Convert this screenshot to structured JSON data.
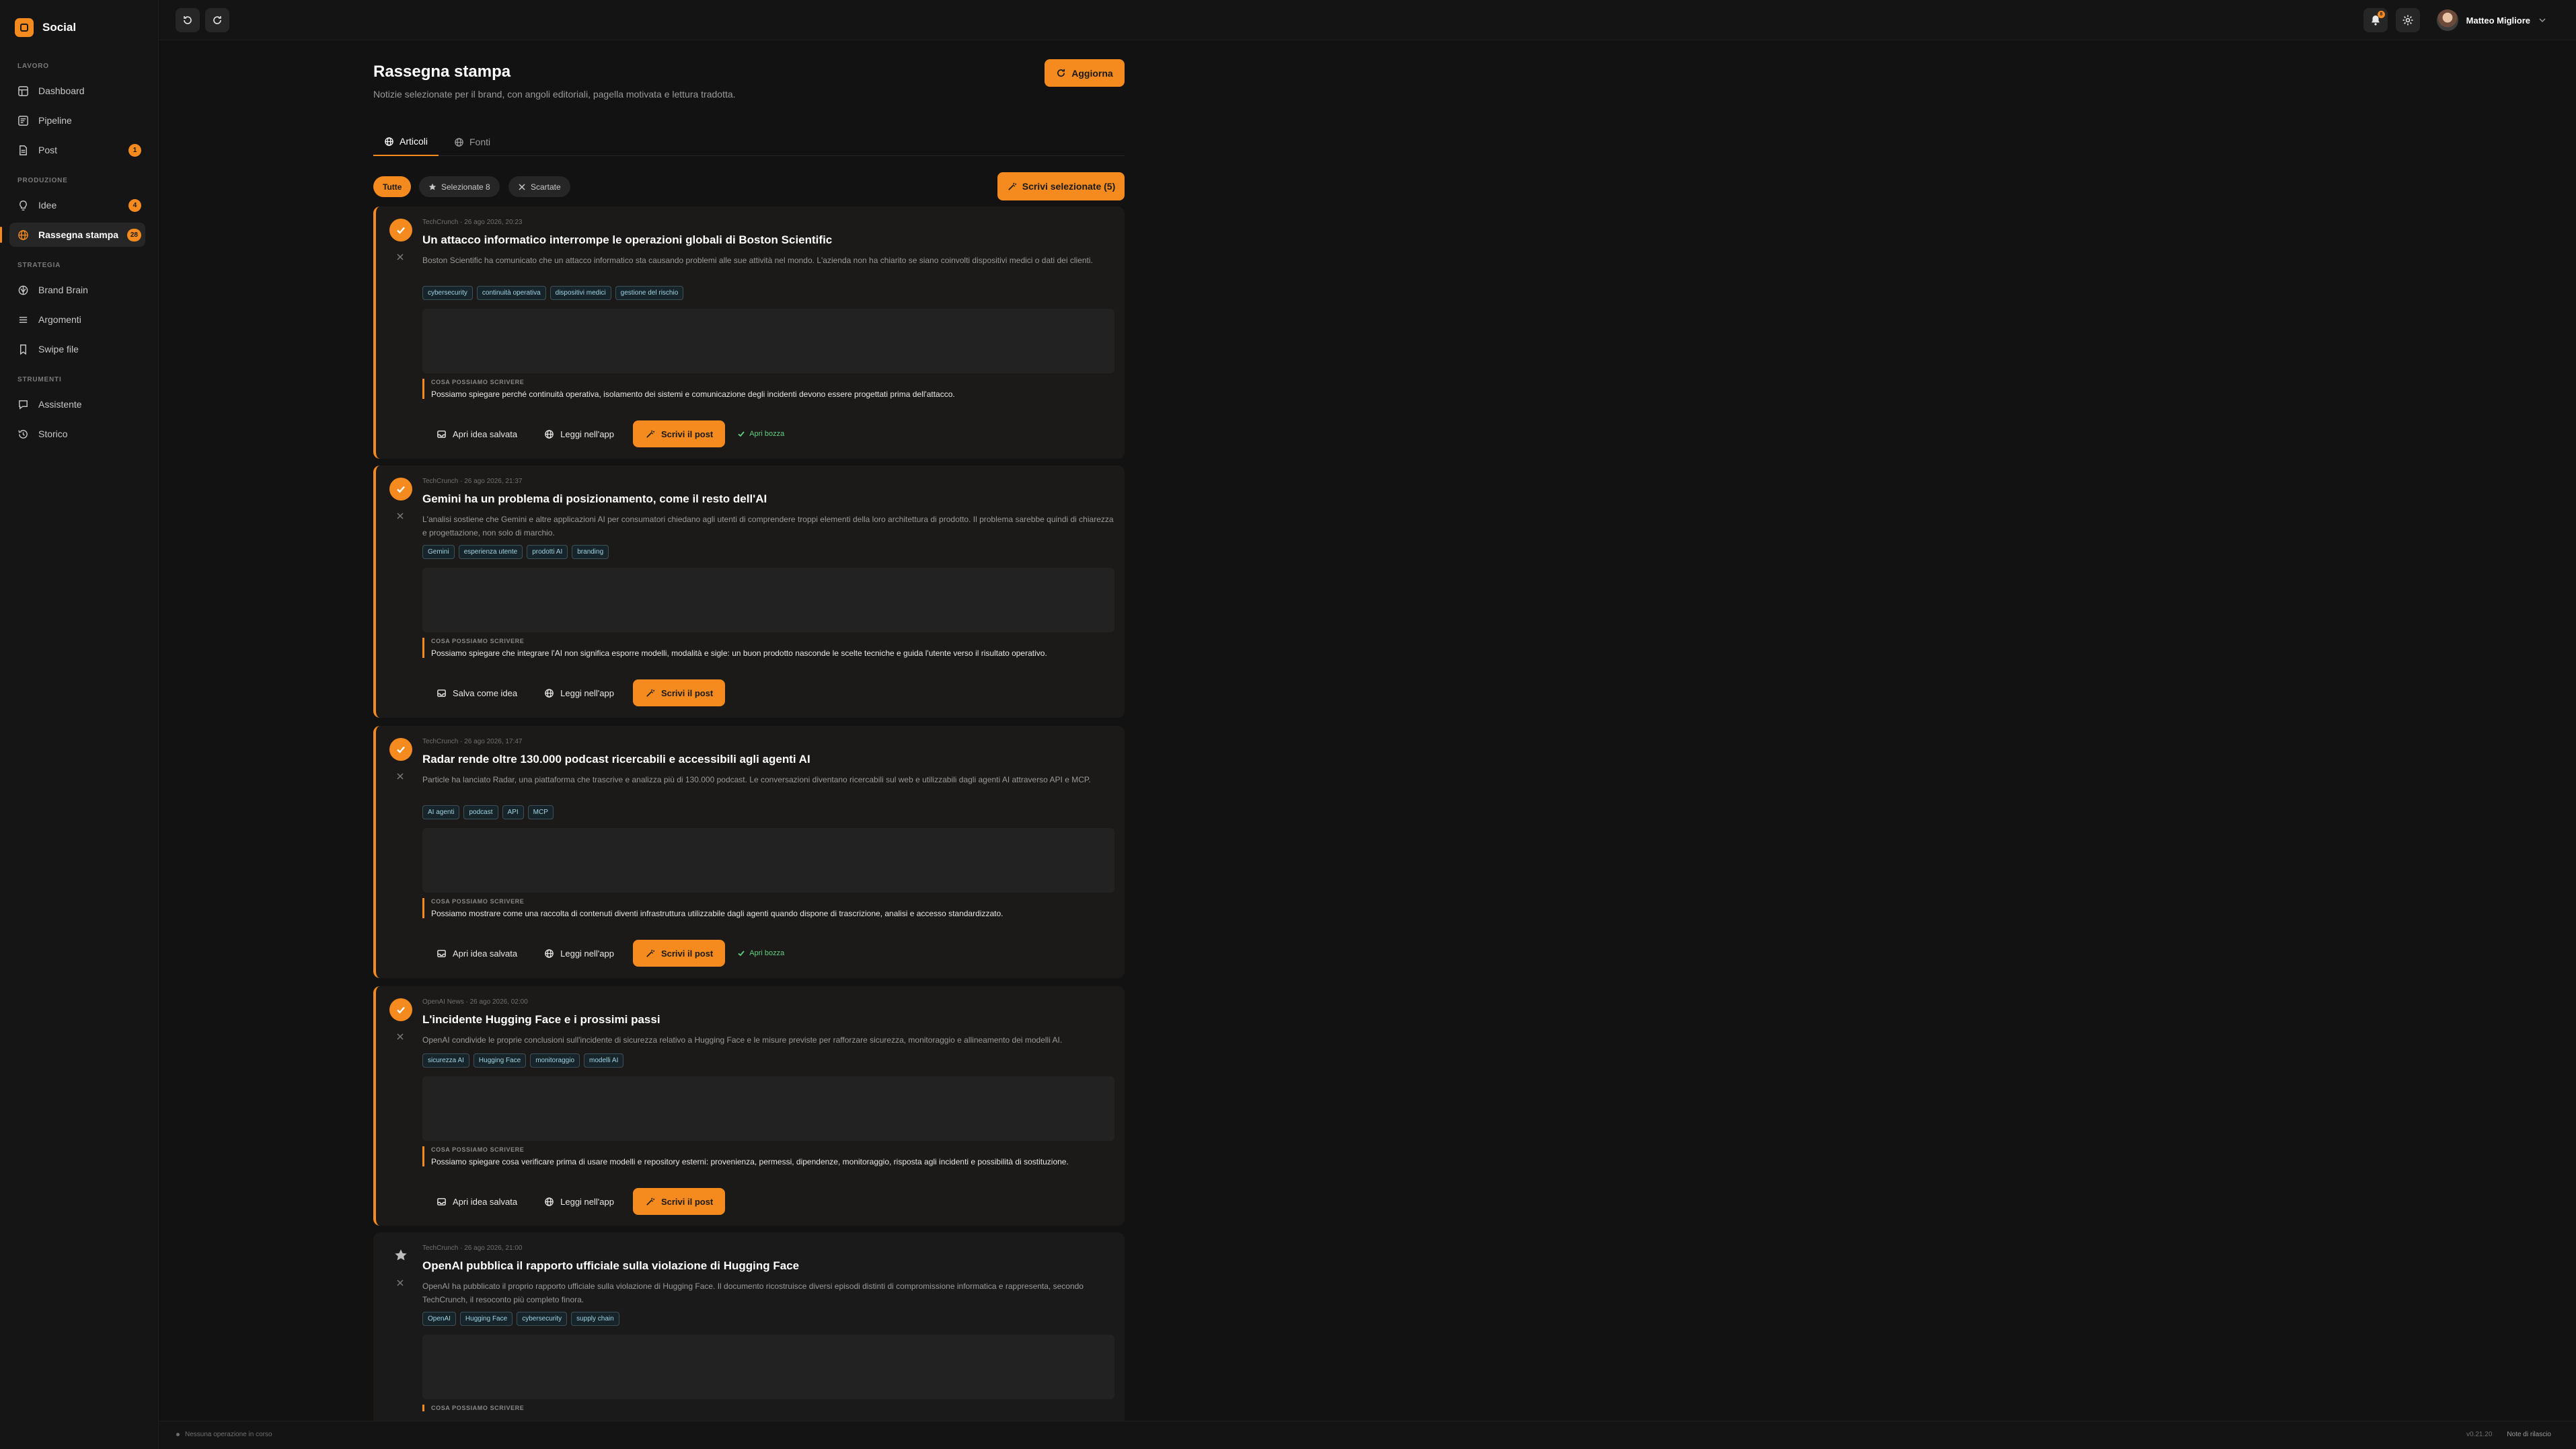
{
  "app": {
    "name": "Social"
  },
  "sidebar": {
    "sections": [
      {
        "label": "LAVORO",
        "items": [
          {
            "label": "Dashboard",
            "icon": "dashboard-icon"
          },
          {
            "label": "Pipeline",
            "icon": "pipeline-icon"
          },
          {
            "label": "Post",
            "icon": "post-icon",
            "badge": "1"
          }
        ]
      },
      {
        "label": "PRODUZIONE",
        "items": [
          {
            "label": "Idee",
            "icon": "bulb-icon",
            "badge": "4"
          },
          {
            "label": "Rassegna stampa",
            "icon": "globe-icon",
            "badge": "28",
            "active": true
          }
        ]
      },
      {
        "label": "STRATEGIA",
        "items": [
          {
            "label": "Brand Brain",
            "icon": "brain-icon"
          },
          {
            "label": "Argomenti",
            "icon": "list-icon"
          },
          {
            "label": "Swipe file",
            "icon": "bookmark-icon"
          }
        ]
      },
      {
        "label": "STRUMENTI",
        "items": [
          {
            "label": "Assistente",
            "icon": "chat-icon"
          },
          {
            "label": "Storico",
            "icon": "history-icon"
          }
        ]
      }
    ]
  },
  "topbar": {
    "notif_count": "8",
    "user_name": "Matteo Migliore"
  },
  "page": {
    "title": "Rassegna stampa",
    "subtitle": "Notizie selezionate per il brand, con angoli editoriali, pagella motivata e lettura tradotta.",
    "refresh_label": "Aggiorna",
    "tabs": [
      {
        "label": "Articoli",
        "active": true
      },
      {
        "label": "Fonti"
      }
    ],
    "filters": [
      {
        "label": "Tutte",
        "active": true
      },
      {
        "label": "Selezionate 8"
      },
      {
        "label": "Scartate"
      }
    ],
    "write_selected_label": "Scrivi selezionate (5)"
  },
  "angle_label": "COSA POSSIAMO SCRIVERE",
  "labels": {
    "open_saved_idea": "Apri idea salvata",
    "save_as_idea": "Salva come idea",
    "read_in_app": "Leggi nell'app",
    "write_post": "Scrivi il post",
    "open_draft": "Apri bozza"
  },
  "articles": [
    {
      "selected": true,
      "meta": "TechCrunch · 26 ago 2026, 20:23",
      "title": "Un attacco informatico interrompe le operazioni globali di Boston Scientific",
      "summary": "Boston Scientific ha comunicato che un attacco informatico sta causando problemi alle sue attività nel mondo. L'azienda non ha chiarito se siano coinvolti dispositivi medici o dati dei clienti.",
      "tags": [
        "cybersecurity",
        "continuità operativa",
        "dispositivi medici",
        "gestione del rischio"
      ],
      "angle": "Possiamo spiegare perché continuità operativa, isolamento dei sistemi e comunicazione degli incidenti devono essere progettati prima dell'attacco.",
      "idea_action": "open_saved_idea",
      "has_draft": true
    },
    {
      "selected": true,
      "meta": "TechCrunch · 26 ago 2026, 21:37",
      "title": "Gemini ha un problema di posizionamento, come il resto dell'AI",
      "summary": "L'analisi sostiene che Gemini e altre applicazioni AI per consumatori chiedano agli utenti di comprendere troppi elementi della loro architettura di prodotto. Il problema sarebbe quindi di chiarezza e progettazione, non solo di marchio.",
      "tags": [
        "Gemini",
        "esperienza utente",
        "prodotti AI",
        "branding"
      ],
      "angle": "Possiamo spiegare che integrare l'AI non significa esporre modelli, modalità e sigle: un buon prodotto nasconde le scelte tecniche e guida l'utente verso il risultato operativo.",
      "idea_action": "save_as_idea",
      "has_draft": false
    },
    {
      "selected": true,
      "meta": "TechCrunch · 26 ago 2026, 17:47",
      "title": "Radar rende oltre 130.000 podcast ricercabili e accessibili agli agenti AI",
      "summary": "Particle ha lanciato Radar, una piattaforma che trascrive e analizza più di 130.000 podcast. Le conversazioni diventano ricercabili sul web e utilizzabili dagli agenti AI attraverso API e MCP.",
      "tags": [
        "AI agenti",
        "podcast",
        "API",
        "MCP"
      ],
      "angle": "Possiamo mostrare come una raccolta di contenuti diventi infrastruttura utilizzabile dagli agenti quando dispone di trascrizione, analisi e accesso standardizzato.",
      "idea_action": "open_saved_idea",
      "has_draft": true
    },
    {
      "selected": true,
      "meta": "OpenAI News · 26 ago 2026, 02:00",
      "title": "L'incidente Hugging Face e i prossimi passi",
      "summary": "OpenAI condivide le proprie conclusioni sull'incidente di sicurezza relativo a Hugging Face e le misure previste per rafforzare sicurezza, monitoraggio e allineamento dei modelli AI.",
      "tags": [
        "sicurezza AI",
        "Hugging Face",
        "monitoraggio",
        "modelli AI"
      ],
      "angle": "Possiamo spiegare cosa verificare prima di usare modelli e repository esterni: provenienza, permessi, dipendenze, monitoraggio, risposta agli incidenti e possibilità di sostituzione.",
      "idea_action": "open_saved_idea",
      "has_draft": false
    },
    {
      "selected": false,
      "meta": "TechCrunch · 26 ago 2026, 21:00",
      "title": "OpenAI pubblica il rapporto ufficiale sulla violazione di Hugging Face",
      "summary": "OpenAI ha pubblicato il proprio rapporto ufficiale sulla violazione di Hugging Face. Il documento ricostruisce diversi episodi distinti di compromissione informatica e rappresenta, secondo TechCrunch, il resoconto più completo finora.",
      "tags": [
        "OpenAI",
        "Hugging Face",
        "cybersecurity",
        "supply chain"
      ],
      "angle": ""
    }
  ],
  "statusbar": {
    "left": "Nessuna operazione in corso",
    "version": "v0.21.20",
    "notes": "Note di rilascio"
  },
  "colors": {
    "accent": "#f58a1f",
    "background": "#121212",
    "card": "#1c1a18",
    "tag_text": "#9fd3e2",
    "success": "#5fcf80"
  }
}
